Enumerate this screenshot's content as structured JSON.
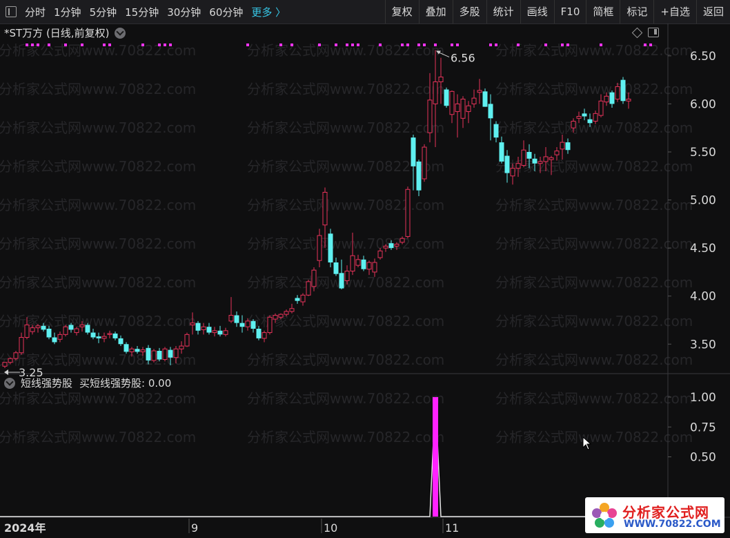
{
  "toolbar": {
    "timeframes": [
      "分时",
      "1分钟",
      "5分钟",
      "15分钟",
      "30分钟",
      "60分钟"
    ],
    "more": "更多 〉",
    "actions": [
      "复权",
      "叠加",
      "多股",
      "统计",
      "画线",
      "F10",
      "简框",
      "标记",
      "+自选",
      "返回"
    ]
  },
  "chart_header": {
    "title": "*ST万方 (日线,前复权)"
  },
  "indicator_header": {
    "name": "短线强势股",
    "value_label": "买短线强势股: 0.00"
  },
  "watermark": "分析家公式网www.70822.com",
  "logo": {
    "name": "分析家公式网",
    "url": "WWW.70822.COM"
  },
  "colors": {
    "up": "#e8335a",
    "down": "#5ff0f0",
    "signal": "#ff22ff",
    "marker": "#ff33ff",
    "axis": "#d9d9d9"
  },
  "chart_data": [
    {
      "type": "candlestick",
      "axis": {
        "y_ticks": [
          3.5,
          4.0,
          4.5,
          5.0,
          5.5,
          6.0,
          6.5
        ],
        "y_range": [
          3.2,
          6.65
        ],
        "x_labels": [
          "2024年",
          "9",
          "10",
          "11"
        ]
      },
      "annotations": {
        "high_label": "6.56",
        "low_label": "3.25"
      },
      "candles": [
        [
          3.27,
          3.31,
          3.25,
          3.31
        ],
        [
          3.31,
          3.36,
          3.29,
          3.35
        ],
        [
          3.35,
          3.43,
          3.33,
          3.41
        ],
        [
          3.41,
          3.62,
          3.39,
          3.57
        ],
        [
          3.57,
          3.78,
          3.55,
          3.7
        ],
        [
          3.63,
          3.7,
          3.6,
          3.67
        ],
        [
          3.67,
          3.71,
          3.62,
          3.69
        ],
        [
          3.69,
          3.72,
          3.63,
          3.65
        ],
        [
          3.66,
          3.69,
          3.55,
          3.57
        ],
        [
          3.57,
          3.62,
          3.5,
          3.52
        ],
        [
          3.55,
          3.63,
          3.52,
          3.6
        ],
        [
          3.6,
          3.7,
          3.58,
          3.68
        ],
        [
          3.7,
          3.72,
          3.62,
          3.65
        ],
        [
          3.62,
          3.68,
          3.59,
          3.66
        ],
        [
          3.68,
          3.74,
          3.63,
          3.7
        ],
        [
          3.7,
          3.72,
          3.6,
          3.62
        ],
        [
          3.62,
          3.66,
          3.55,
          3.57
        ],
        [
          3.58,
          3.62,
          3.51,
          3.56
        ],
        [
          3.56,
          3.62,
          3.52,
          3.58
        ],
        [
          3.6,
          3.64,
          3.56,
          3.61
        ],
        [
          3.61,
          3.63,
          3.54,
          3.56
        ],
        [
          3.56,
          3.59,
          3.48,
          3.5
        ],
        [
          3.5,
          3.52,
          3.4,
          3.42
        ],
        [
          3.42,
          3.47,
          3.37,
          3.45
        ],
        [
          3.45,
          3.48,
          3.4,
          3.42
        ],
        [
          3.42,
          3.47,
          3.38,
          3.44
        ],
        [
          3.46,
          3.49,
          3.29,
          3.33
        ],
        [
          3.33,
          3.45,
          3.31,
          3.43
        ],
        [
          3.43,
          3.46,
          3.32,
          3.34
        ],
        [
          3.34,
          3.47,
          3.32,
          3.45
        ],
        [
          3.44,
          3.47,
          3.28,
          3.36
        ],
        [
          3.36,
          3.48,
          3.3,
          3.45
        ],
        [
          3.45,
          3.53,
          3.4,
          3.48
        ],
        [
          3.48,
          3.62,
          3.47,
          3.6
        ],
        [
          3.7,
          3.83,
          3.6,
          3.72
        ],
        [
          3.72,
          3.74,
          3.6,
          3.64
        ],
        [
          3.65,
          3.72,
          3.6,
          3.68
        ],
        [
          3.68,
          3.72,
          3.6,
          3.62
        ],
        [
          3.62,
          3.68,
          3.58,
          3.64
        ],
        [
          3.64,
          3.69,
          3.58,
          3.6
        ],
        [
          3.6,
          3.67,
          3.58,
          3.64
        ],
        [
          3.74,
          3.99,
          3.72,
          3.8
        ],
        [
          3.8,
          3.84,
          3.68,
          3.72
        ],
        [
          3.72,
          3.8,
          3.62,
          3.68
        ],
        [
          3.68,
          3.77,
          3.64,
          3.74
        ],
        [
          3.74,
          3.76,
          3.62,
          3.66
        ],
        [
          3.66,
          3.69,
          3.54,
          3.56
        ],
        [
          3.56,
          3.64,
          3.52,
          3.62
        ],
        [
          3.62,
          3.8,
          3.6,
          3.78
        ],
        [
          3.76,
          3.82,
          3.72,
          3.8
        ],
        [
          3.78,
          3.82,
          3.76,
          3.81
        ],
        [
          3.81,
          3.86,
          3.79,
          3.84
        ],
        [
          3.84,
          3.92,
          3.82,
          3.87
        ],
        [
          3.98,
          4.01,
          3.92,
          3.95
        ],
        [
          3.94,
          4.03,
          3.9,
          4.01
        ],
        [
          4.01,
          4.17,
          4.0,
          4.15
        ],
        [
          4.1,
          4.3,
          4.05,
          4.27
        ],
        [
          4.37,
          4.7,
          4.3,
          4.63
        ],
        [
          4.74,
          5.13,
          4.5,
          5.08
        ],
        [
          4.65,
          4.7,
          4.3,
          4.35
        ],
        [
          4.35,
          4.4,
          4.21,
          4.23
        ],
        [
          4.24,
          4.38,
          4.07,
          4.08
        ],
        [
          4.16,
          4.32,
          4.12,
          4.26
        ],
        [
          4.26,
          4.66,
          4.22,
          4.42
        ],
        [
          4.32,
          4.43,
          4.3,
          4.38
        ],
        [
          4.38,
          4.42,
          4.26,
          4.28
        ],
        [
          4.28,
          4.37,
          4.22,
          4.35
        ],
        [
          4.25,
          4.39,
          4.2,
          4.35
        ],
        [
          4.4,
          4.5,
          4.38,
          4.47
        ],
        [
          4.5,
          4.54,
          4.46,
          4.52
        ],
        [
          4.55,
          4.58,
          4.48,
          4.5
        ],
        [
          4.52,
          4.56,
          4.48,
          4.54
        ],
        [
          4.56,
          4.62,
          4.54,
          4.6
        ],
        [
          4.62,
          5.14,
          4.6,
          5.11
        ],
        [
          5.65,
          5.68,
          5.1,
          5.35
        ],
        [
          5.4,
          5.42,
          5.04,
          5.1
        ],
        [
          5.22,
          5.58,
          5.19,
          5.55
        ],
        [
          5.7,
          6.32,
          5.6,
          6.04
        ],
        [
          6.0,
          6.56,
          5.55,
          6.23
        ],
        [
          6.23,
          6.48,
          6.0,
          6.28
        ],
        [
          6.15,
          6.17,
          5.96,
          5.98
        ],
        [
          5.89,
          6.14,
          5.8,
          6.13
        ],
        [
          5.92,
          6.1,
          5.65,
          6.0
        ],
        [
          5.85,
          6.08,
          5.75,
          6.05
        ],
        [
          5.92,
          6.03,
          5.8,
          5.98
        ],
        [
          6.0,
          6.15,
          5.96,
          6.06
        ],
        [
          6.12,
          6.26,
          6.0,
          6.14
        ],
        [
          6.13,
          6.16,
          5.97,
          5.97
        ],
        [
          6.0,
          6.1,
          5.62,
          5.85
        ],
        [
          5.79,
          5.82,
          5.6,
          5.65
        ],
        [
          5.6,
          5.66,
          5.38,
          5.4
        ],
        [
          5.46,
          5.52,
          5.18,
          5.28
        ],
        [
          5.25,
          5.38,
          5.16,
          5.33
        ],
        [
          5.33,
          5.45,
          5.24,
          5.38
        ],
        [
          5.36,
          5.62,
          5.34,
          5.52
        ],
        [
          5.5,
          5.58,
          5.33,
          5.43
        ],
        [
          5.43,
          5.48,
          5.3,
          5.38
        ],
        [
          5.38,
          5.45,
          5.28,
          5.4
        ],
        [
          5.4,
          5.55,
          5.3,
          5.45
        ],
        [
          5.42,
          5.46,
          5.26,
          5.44
        ],
        [
          5.47,
          5.55,
          5.41,
          5.51
        ],
        [
          5.53,
          5.68,
          5.42,
          5.6
        ],
        [
          5.6,
          5.64,
          5.48,
          5.52
        ],
        [
          5.75,
          5.85,
          5.7,
          5.82
        ],
        [
          5.85,
          5.92,
          5.8,
          5.87
        ],
        [
          5.9,
          5.95,
          5.83,
          5.87
        ],
        [
          5.84,
          5.9,
          5.76,
          5.8
        ],
        [
          5.82,
          5.93,
          5.79,
          5.9
        ],
        [
          5.88,
          6.1,
          5.86,
          6.03
        ],
        [
          6.02,
          6.12,
          5.98,
          6.08
        ],
        [
          6.12,
          6.14,
          5.96,
          6.0
        ],
        [
          6.05,
          6.22,
          6.02,
          6.18
        ],
        [
          6.25,
          6.28,
          6.0,
          6.03
        ],
        [
          6.03,
          6.12,
          5.95,
          6.05
        ]
      ],
      "top_markers": [
        4,
        5,
        6,
        8,
        11,
        14,
        18,
        19,
        25,
        28,
        29,
        30,
        44,
        50,
        52,
        57,
        60,
        62,
        63,
        64,
        68,
        72,
        73,
        75,
        76,
        78,
        81,
        82,
        88,
        89,
        93,
        98,
        101,
        102,
        108,
        116,
        117
      ]
    },
    {
      "type": "line",
      "name": "短线强势股",
      "axis": {
        "y_ticks": [
          0.5,
          0.75,
          1.0
        ],
        "y_range": [
          0,
          1.0
        ]
      },
      "signal_index": 78,
      "values_note": "0 everywhere except index 78 = 1.0"
    }
  ]
}
